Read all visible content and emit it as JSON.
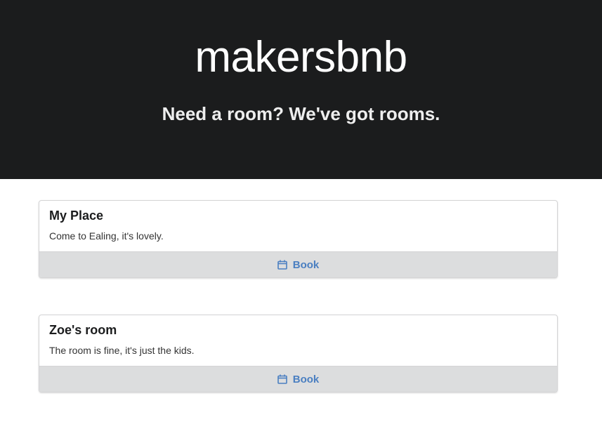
{
  "header": {
    "title": "makersbnb",
    "subtitle": "Need a room? We've got rooms."
  },
  "listings": [
    {
      "title": "My Place",
      "description": "Come to Ealing, it's lovely.",
      "book_label": "Book",
      "book_icon": "calendar-icon"
    },
    {
      "title": "Zoe's room",
      "description": "The room is fine, it's just the kids.",
      "book_label": "Book",
      "book_icon": "calendar-icon"
    }
  ],
  "colors": {
    "header_bg": "#1b1c1d",
    "button_bg": "#dcddde",
    "button_text": "#4a7fc1"
  }
}
